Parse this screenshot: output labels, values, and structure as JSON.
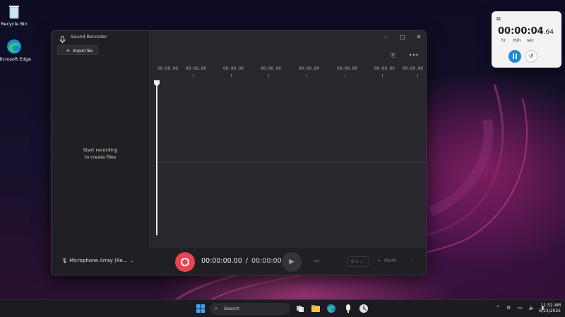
{
  "desktop": {
    "icons": [
      {
        "label": "Recycle Bin"
      },
      {
        "label": "Microsoft Edge"
      }
    ]
  },
  "window": {
    "title": "Sound Recorder",
    "controls": {
      "minimize": "–",
      "maximize": "□",
      "close": "✕"
    },
    "sidebar": {
      "import_label": "Import file",
      "empty_line1": "Start recording",
      "empty_line2": "to create files"
    },
    "timeline": {
      "ticks": [
        "00:00.00",
        "00:00.00",
        "00:00.00",
        "00:00.00",
        "00:00.00",
        "00:00.00",
        "00:00.00",
        "00:00.00"
      ]
    },
    "controls_bar": {
      "microphone": "Microphone Array (Re...",
      "current_time": "00:00:00.00",
      "separator": "/",
      "total_time": "00:00:00",
      "speed": "0 x",
      "mark_label": "Mark"
    }
  },
  "clock_widget": {
    "time": "00:00:04",
    "fraction": ".64",
    "units": {
      "hr": "hr",
      "min": "min",
      "sec": "sec"
    }
  },
  "taskbar": {
    "search_label": "Search",
    "time": "11:52 AM",
    "date": "6/23/2025"
  },
  "colors": {
    "record": "#e8454f",
    "accent_blue": "#1e8ad6",
    "window_bg": "#232228"
  }
}
